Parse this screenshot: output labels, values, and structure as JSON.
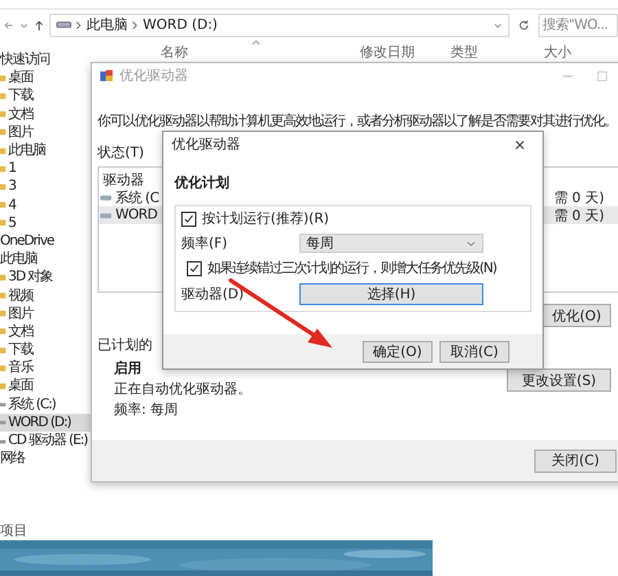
{
  "explorer": {
    "address": {
      "path": [
        "此电脑",
        "WORD (D:)"
      ]
    },
    "search": {
      "placeholder": "搜索\"WO..."
    },
    "columns": [
      "名称",
      "修改日期",
      "类型",
      "大小"
    ],
    "sidebar": [
      {
        "label": "快速访问",
        "kind": "header",
        "selected": false
      },
      {
        "label": "桌面",
        "kind": "item",
        "selected": false
      },
      {
        "label": "下载",
        "kind": "item",
        "selected": false
      },
      {
        "label": "文档",
        "kind": "item",
        "selected": false
      },
      {
        "label": "图片",
        "kind": "item",
        "selected": false
      },
      {
        "label": "此电脑",
        "kind": "item",
        "selected": false
      },
      {
        "label": "1",
        "kind": "item",
        "selected": false
      },
      {
        "label": "3",
        "kind": "item",
        "selected": false
      },
      {
        "label": "4",
        "kind": "item",
        "selected": false
      },
      {
        "label": "5",
        "kind": "item",
        "selected": false
      },
      {
        "label": "OneDrive",
        "kind": "header",
        "selected": false
      },
      {
        "label": "此电脑",
        "kind": "header",
        "selected": false
      },
      {
        "label": "3D 对象",
        "kind": "item",
        "selected": false
      },
      {
        "label": "视频",
        "kind": "item",
        "selected": false
      },
      {
        "label": "图片",
        "kind": "item",
        "selected": false
      },
      {
        "label": "文档",
        "kind": "item",
        "selected": false
      },
      {
        "label": "下载",
        "kind": "item",
        "selected": false
      },
      {
        "label": "音乐",
        "kind": "item",
        "selected": false
      },
      {
        "label": "桌面",
        "kind": "item",
        "selected": false
      },
      {
        "label": "系统 (C:)",
        "kind": "drive",
        "selected": false
      },
      {
        "label": "WORD (D:)",
        "kind": "drive",
        "selected": true
      },
      {
        "label": "CD 驱动器 (E:)",
        "kind": "drive",
        "selected": false
      },
      {
        "label": "网络",
        "kind": "header",
        "selected": false
      }
    ],
    "status_bar": "项目"
  },
  "optimize_dialog": {
    "title": "优化驱动器",
    "description": "你可以优化驱动器以帮助计算机更高效地运行，或者分析驱动器以了解是否需要对其进行优化。",
    "status_label": "状态(T)",
    "list": {
      "header": "驱动器",
      "rows": [
        {
          "name": "系统 (C",
          "status": "需 0 天)",
          "selected": false
        },
        {
          "name": "WORD",
          "status": "需 0 天)",
          "selected": true
        }
      ]
    },
    "optimize_button": "优化(O)",
    "scheduled_label": "已计划的",
    "schedule_state": "启用",
    "schedule_lines": [
      "正在自动优化驱动器。",
      "频率: 每周"
    ],
    "change_button": "更改设置(S)",
    "close_button": "关闭(C)"
  },
  "schedule_dialog": {
    "title": "优化驱动器",
    "heading": "优化计划",
    "run_on_schedule": {
      "label": "按计划运行(推荐)(R)",
      "checked": true
    },
    "frequency": {
      "label": "频率(F)",
      "value": "每周"
    },
    "raise_priority": {
      "label": "如果连续错过三次计划的运行，则增大任务优先级(N)",
      "checked": true
    },
    "drives": {
      "label": "驱动器(D)",
      "button": "选择(H)"
    },
    "buttons": [
      {
        "label": "确定(O)"
      },
      {
        "label": "取消(C)"
      }
    ]
  }
}
